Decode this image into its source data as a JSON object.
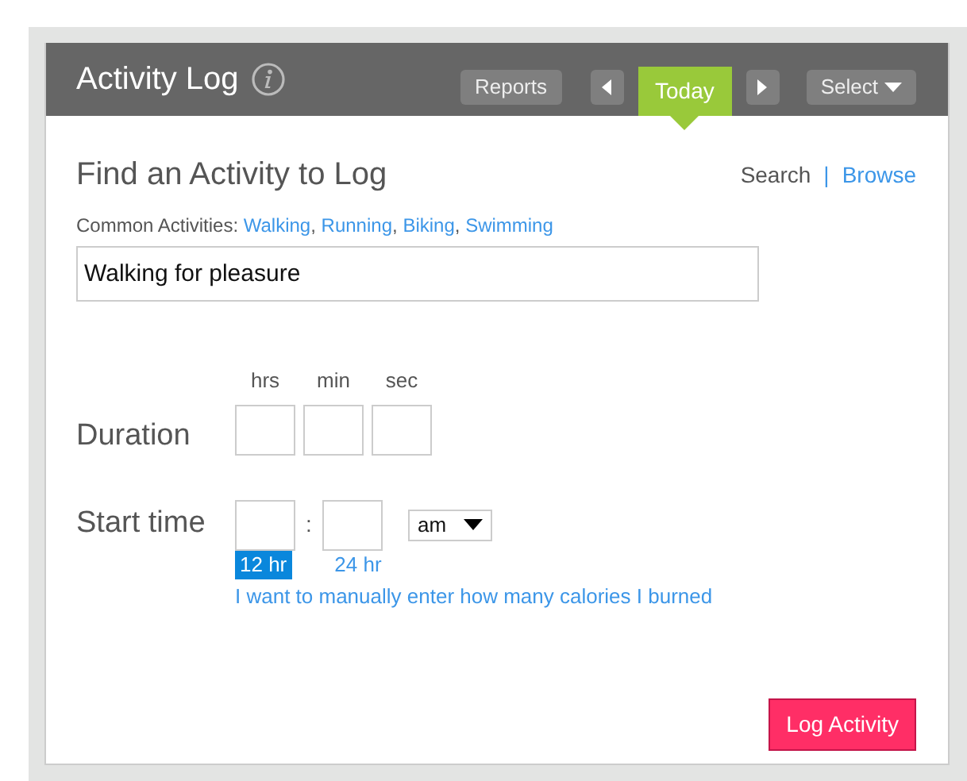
{
  "header": {
    "title": "Activity Log",
    "reports": "Reports",
    "today": {
      "label": "Today",
      "selected": true
    },
    "select": "Select"
  },
  "finder": {
    "heading": "Find an Activity to Log",
    "modes": [
      {
        "label": "Search",
        "selected": true
      },
      {
        "label": "Browse",
        "selected": false
      }
    ],
    "mode_separator": "|",
    "common_separator": ",",
    "common_label": "Common Activities:",
    "common": [
      "Walking",
      "Running",
      "Biking",
      "Swimming"
    ],
    "value": "Walking for pleasure"
  },
  "duration": {
    "label": "Duration",
    "units": [
      "hrs",
      "min",
      "sec"
    ]
  },
  "start_time": {
    "label": "Start time",
    "separator": ":",
    "ampm": "am",
    "formats": [
      {
        "label": "12 hr",
        "selected": true
      },
      {
        "label": "24 hr",
        "selected": false
      }
    ]
  },
  "manual_link": "I want to manually enter how many calories I burned",
  "submit": "Log Activity"
}
